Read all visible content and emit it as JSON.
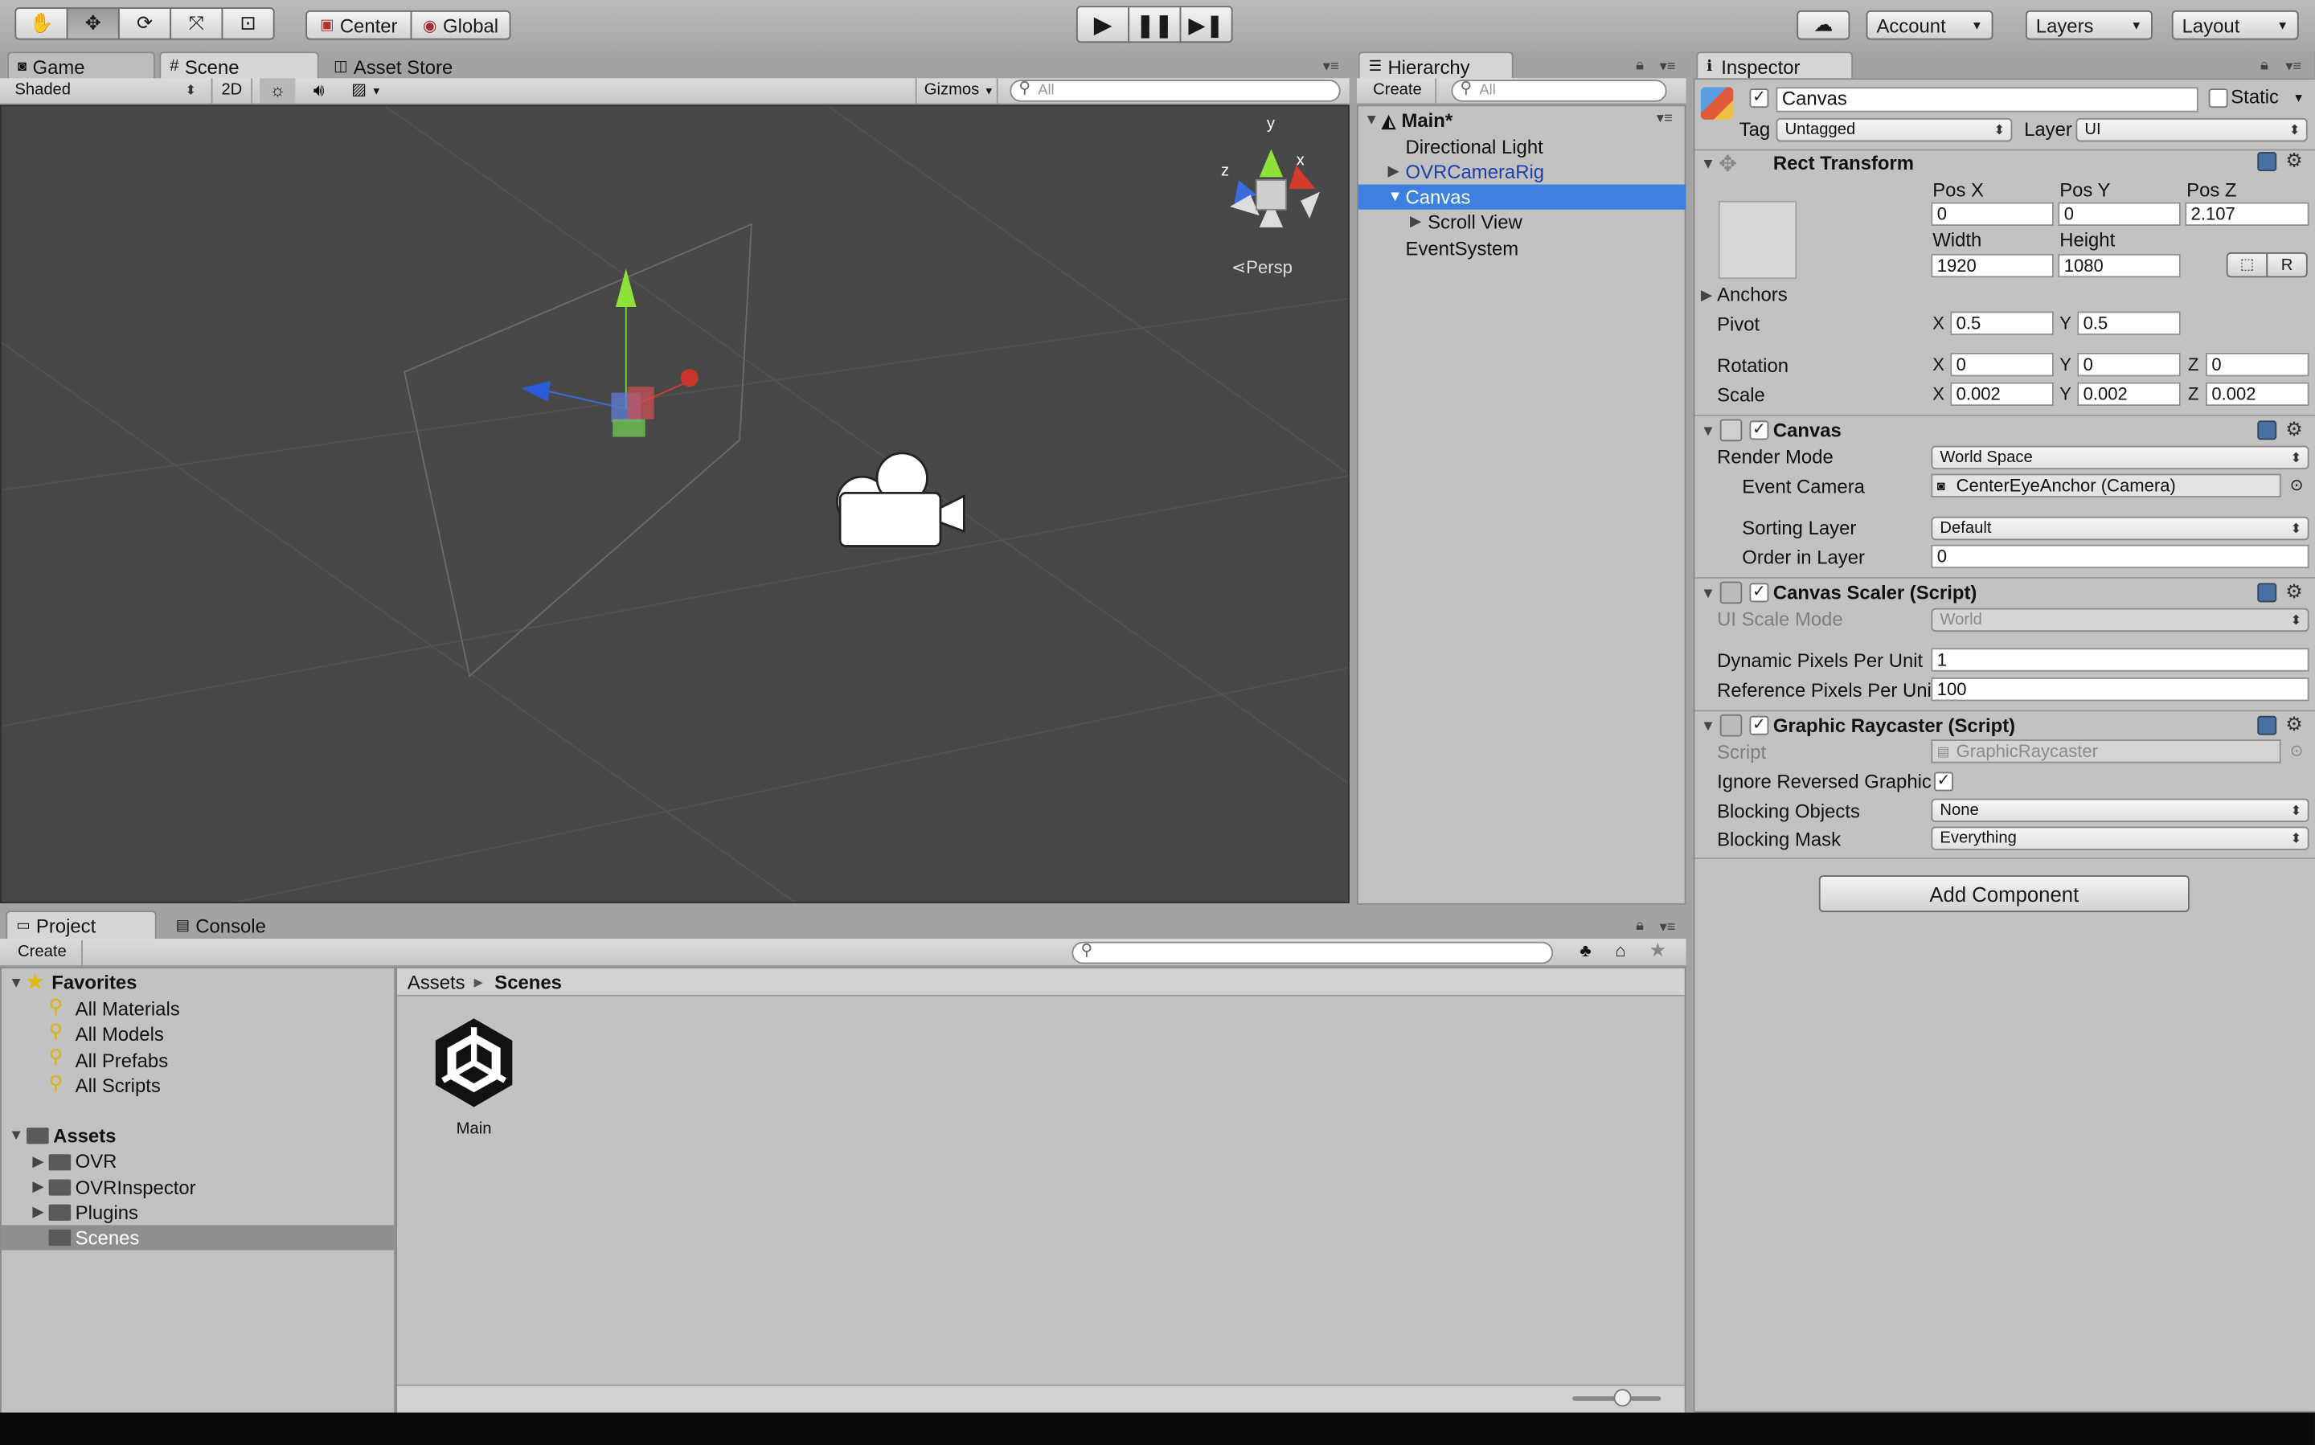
{
  "toolbar": {
    "pivot": "Center",
    "space": "Global",
    "account": "Account",
    "layers": "Layers",
    "layout": "Layout"
  },
  "scene": {
    "tabs": [
      "Game",
      "Scene",
      "Asset Store"
    ],
    "shading": "Shaded",
    "mode2d": "2D",
    "gizmos": "Gizmos",
    "search_placeholder": "All",
    "persp": "Persp",
    "axis_x": "x",
    "axis_y": "y",
    "axis_z": "z"
  },
  "hierarchy": {
    "tab": "Hierarchy",
    "create": "Create",
    "search_placeholder": "All",
    "scene_name": "Main*",
    "items": [
      "Directional Light",
      "OVRCameraRig",
      "Canvas",
      "Scroll View",
      "EventSystem"
    ]
  },
  "inspector": {
    "tab": "Inspector",
    "object_name": "Canvas",
    "static_label": "Static",
    "tag_label": "Tag",
    "tag_value": "Untagged",
    "layer_label": "Layer",
    "layer_value": "UI",
    "rect": {
      "title": "Rect Transform",
      "posx_label": "Pos X",
      "posy_label": "Pos Y",
      "posz_label": "Pos Z",
      "posx": "0",
      "posy": "0",
      "posz": "2.107",
      "width_label": "Width",
      "height_label": "Height",
      "width": "1920",
      "height": "1080",
      "r_button": "R",
      "anchors": "Anchors",
      "pivot": "Pivot",
      "pivot_x": "0.5",
      "pivot_y": "0.5",
      "rotation": "Rotation",
      "rot_x": "0",
      "rot_y": "0",
      "rot_z": "0",
      "scale": "Scale",
      "scale_x": "0.002",
      "scale_y": "0.002",
      "scale_z": "0.002",
      "x": "X",
      "y": "Y",
      "z": "Z"
    },
    "canvas": {
      "title": "Canvas",
      "render_mode_label": "Render Mode",
      "render_mode": "World Space",
      "event_camera_label": "Event Camera",
      "event_camera": "CenterEyeAnchor (Camera)",
      "sorting_layer_label": "Sorting Layer",
      "sorting_layer": "Default",
      "order_label": "Order in Layer",
      "order": "0"
    },
    "scaler": {
      "title": "Canvas Scaler (Script)",
      "ui_scale_label": "UI Scale Mode",
      "ui_scale": "World",
      "dpu_label": "Dynamic Pixels Per Unit",
      "dpu": "1",
      "rpu_label": "Reference Pixels Per Unit",
      "rpu": "100"
    },
    "raycaster": {
      "title": "Graphic Raycaster (Script)",
      "script_label": "Script",
      "script": "GraphicRaycaster",
      "ignore_label": "Ignore Reversed Graphic",
      "blocking_objects_label": "Blocking Objects",
      "blocking_objects": "None",
      "blocking_mask_label": "Blocking Mask",
      "blocking_mask": "Everything"
    },
    "add_component": "Add Component"
  },
  "project": {
    "tabs": [
      "Project",
      "Console"
    ],
    "create": "Create",
    "favorites": "Favorites",
    "fav_items": [
      "All Materials",
      "All Models",
      "All Prefabs",
      "All Scripts"
    ],
    "assets": "Assets",
    "asset_items": [
      "OVR",
      "OVRInspector",
      "Plugins",
      "Scenes"
    ],
    "breadcrumb_root": "Assets",
    "breadcrumb_current": "Scenes",
    "file_name": "Main"
  },
  "colors": {
    "selection": "#3d80df",
    "scene_bg": "#474747",
    "panel_bg": "#c2c2c2",
    "link_blue": "#1a3fa8"
  }
}
